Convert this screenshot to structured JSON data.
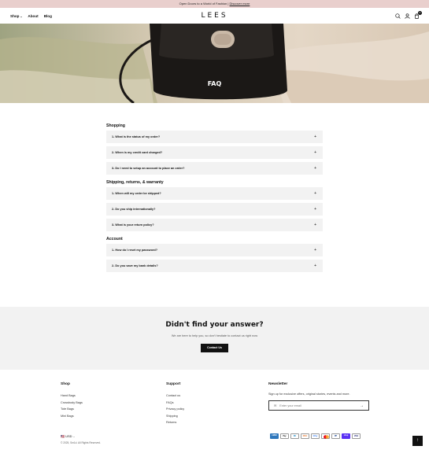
{
  "announcement": {
    "text": "Open Doors to a World of Fashion |",
    "link": "Discover more"
  },
  "header": {
    "nav": [
      {
        "label": "Shop"
      },
      {
        "label": "About"
      },
      {
        "label": "Blog"
      }
    ],
    "logo": "LEES",
    "icons": [
      "search-icon",
      "user-icon",
      "cart-icon"
    ],
    "cart_count": "0"
  },
  "hero": {
    "title": "FAQ"
  },
  "faq": {
    "sections": [
      {
        "title": "Shopping",
        "questions": [
          "1- What is the status of my order?",
          "2- When is my credit card charged?",
          "3- Do I need to setup an account to place an order?"
        ]
      },
      {
        "title": "Shipping, returns, & warranty",
        "questions": [
          "1- When will my order be shipped?",
          "2- Do you ship internationally?",
          "3- What is your return policy?"
        ]
      },
      {
        "title": "Account",
        "questions": [
          "1- How do I reset my password?",
          "2- Do you save my bank details?"
        ]
      }
    ]
  },
  "cta": {
    "title": "Didn't find your answer?",
    "subtitle": "We are here to help you, so don't hesitate to contact us right now",
    "button": "Contact Us"
  },
  "footer": {
    "shop": {
      "title": "Shop",
      "links": [
        "Hand Bags",
        "Crossbody Bags",
        "Tote Bags",
        "Mini Bags"
      ]
    },
    "support": {
      "title": "Support",
      "links": [
        "Contact us",
        "FAQs",
        "Privacy policy",
        "Shipping",
        "Returns"
      ]
    },
    "newsletter": {
      "title": "Newsletter",
      "description": "Sign up for exclusive offers, original stories, events and more.",
      "placeholder": "Enter your email"
    },
    "currency": "USD",
    "copyright": "© 2025, Sm1d. All Rights Reserved.",
    "payments": [
      "American Express",
      "Apple Pay",
      "Diners Club",
      "Discover",
      "Google Pay",
      "Mastercard",
      "PayPal",
      "Shop Pay",
      "Visa"
    ]
  },
  "colors": {
    "announcement_bg": "#e9cfcd",
    "cta_bg": "#f2f2f2",
    "question_bg": "#f2f2f2",
    "button_bg": "#111111"
  }
}
